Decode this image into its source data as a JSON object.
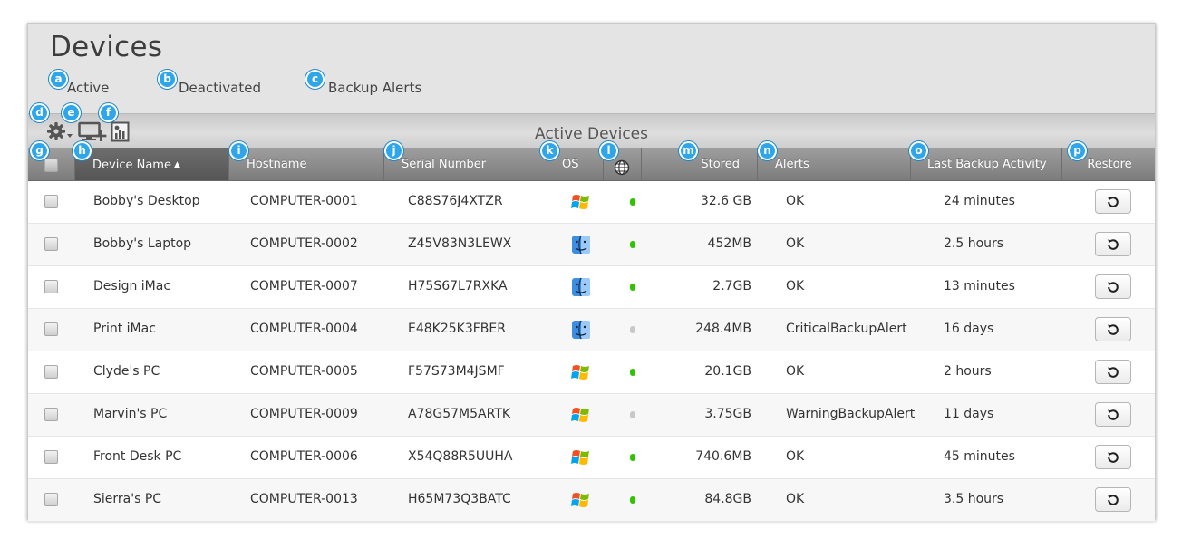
{
  "page": {
    "title": "Devices"
  },
  "tabs": [
    {
      "label": "Active",
      "badge": "a"
    },
    {
      "label": "Deactivated",
      "badge": "b"
    },
    {
      "label": "Backup Alerts",
      "badge": "c"
    }
  ],
  "toolbar": {
    "title": "Active Devices",
    "icons": [
      {
        "name": "gear-icon",
        "badge": "d"
      },
      {
        "name": "add-device-icon",
        "badge": "e"
      },
      {
        "name": "report-icon",
        "badge": "f"
      }
    ]
  },
  "columns": [
    {
      "key": "select",
      "label": "",
      "badge": "g"
    },
    {
      "key": "device_name",
      "label": "Device Name",
      "badge": "h",
      "sorted": "asc",
      "sort_indicator": "▲"
    },
    {
      "key": "hostname",
      "label": "Hostname",
      "badge": "i"
    },
    {
      "key": "serial",
      "label": "Serial Number",
      "badge": "j"
    },
    {
      "key": "os",
      "label": "OS",
      "badge": "k"
    },
    {
      "key": "online",
      "label": "",
      "icon": "globe-icon",
      "badge": "l"
    },
    {
      "key": "stored",
      "label": "Stored",
      "badge": "m"
    },
    {
      "key": "alerts",
      "label": "Alerts",
      "badge": "n"
    },
    {
      "key": "last_backup",
      "label": "Last Backup Activity",
      "badge": "o"
    },
    {
      "key": "restore",
      "label": "Restore",
      "badge": "p"
    }
  ],
  "rows": [
    {
      "name": "Bobby's Desktop",
      "hostname": "COMPUTER-0001",
      "serial": "C88S76J4XTZR",
      "os": "windows",
      "online": true,
      "stored": "32.6 GB",
      "alerts": "OK",
      "last_backup": "24 minutes"
    },
    {
      "name": "Bobby's Laptop",
      "hostname": "COMPUTER-0002",
      "serial": "Z45V83N3LEWX",
      "os": "mac",
      "online": true,
      "stored": "452MB",
      "alerts": "OK",
      "last_backup": "2.5 hours"
    },
    {
      "name": "Design iMac",
      "hostname": "COMPUTER-0007",
      "serial": "H75S67L7RXKA",
      "os": "mac",
      "online": true,
      "stored": "2.7GB",
      "alerts": "OK",
      "last_backup": "13 minutes"
    },
    {
      "name": "Print iMac",
      "hostname": "COMPUTER-0004",
      "serial": "E48K25K3FBER",
      "os": "mac",
      "online": false,
      "stored": "248.4MB",
      "alerts": "CriticalBackupAlert",
      "last_backup": "16 days"
    },
    {
      "name": "Clyde's PC",
      "hostname": "COMPUTER-0005",
      "serial": "F57S73M4JSMF",
      "os": "windows",
      "online": true,
      "stored": "20.1GB",
      "alerts": "OK",
      "last_backup": "2 hours"
    },
    {
      "name": "Marvin's PC",
      "hostname": "COMPUTER-0009",
      "serial": "A78G57M5ARTK",
      "os": "windows",
      "online": false,
      "stored": "3.75GB",
      "alerts": "WarningBackupAlert",
      "last_backup": "11 days"
    },
    {
      "name": "Front Desk PC",
      "hostname": "COMPUTER-0006",
      "serial": "X54Q88R5UUHA",
      "os": "windows",
      "online": true,
      "stored": "740.6MB",
      "alerts": "OK",
      "last_backup": "45 minutes"
    },
    {
      "name": "Sierra's PC",
      "hostname": "COMPUTER-0013",
      "serial": "H65M73Q3BATC",
      "os": "windows",
      "online": true,
      "stored": "84.8GB",
      "alerts": "OK",
      "last_backup": "3.5 hours"
    }
  ],
  "colors": {
    "online": "#2fc400",
    "offline": "#c8c8c8",
    "badge": "#2fa6ea",
    "header_gradient_top": "#9e9e9e",
    "header_gradient_bottom": "#7c7c7c"
  }
}
